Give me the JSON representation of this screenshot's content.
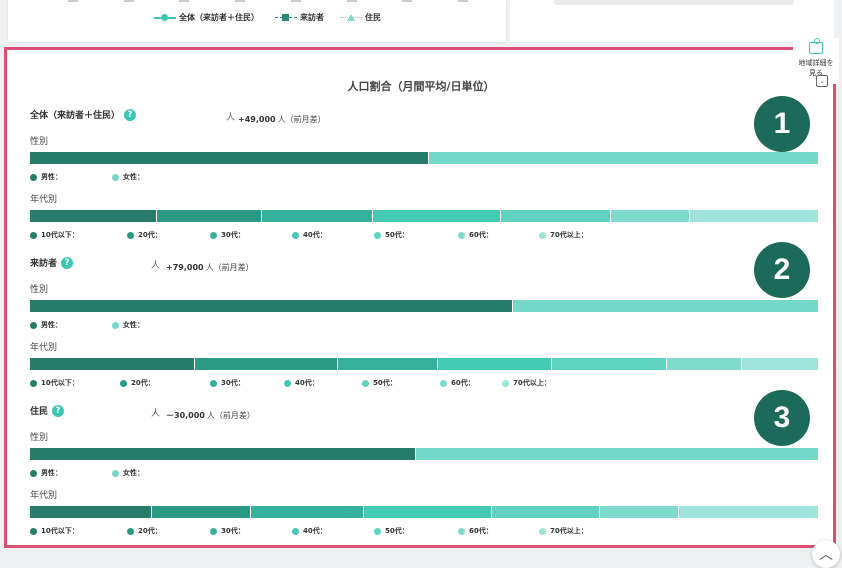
{
  "top_legend": [
    {
      "label": "全体（来訪者＋住民）",
      "color": "#3cc8b4",
      "marker": "circle",
      "line": "solid"
    },
    {
      "label": "来訪者",
      "color": "#2a8a76",
      "marker": "square",
      "line": "dash"
    },
    {
      "label": "住民",
      "color": "#7fdccd",
      "marker": "tri",
      "line": "dot"
    }
  ],
  "chart_title": "人口割合（月間平均/日単位）",
  "side_button": {
    "label_line1": "地域詳細を",
    "label_line2": "見る",
    "icon": "map-pin-icon"
  },
  "collapse_icon": "chevron-up-icon",
  "sex_label": "性別",
  "age_label": "年代別",
  "person_glyph": "人",
  "diff_unit": "人（前月差）",
  "sex_legend": [
    "男性：",
    "女性："
  ],
  "age_legend": [
    "10代以下：",
    "20代：",
    "30代：",
    "40代：",
    "50代：",
    "60代：",
    "70代以上："
  ],
  "sex_colors": [
    "#267c69",
    "#74d9c8"
  ],
  "age_colors": [
    "#267c69",
    "#2b9a84",
    "#36b29c",
    "#44c9b3",
    "#5ed3c0",
    "#7fdccd",
    "#9fe4d9"
  ],
  "sections": [
    {
      "title": "全体（来訪者＋住民）",
      "diff": "+49,000",
      "badge": "1",
      "sex_ratio": [
        0.506,
        0.494
      ],
      "age_ratio": [
        0.161,
        0.133,
        0.141,
        0.163,
        0.139,
        0.1,
        0.163
      ]
    },
    {
      "title": "来訪者",
      "diff": "+79,000",
      "badge": "2",
      "sex_ratio": [
        0.613,
        0.387
      ],
      "age_ratio": [
        0.21,
        0.181,
        0.127,
        0.145,
        0.146,
        0.095,
        0.096
      ]
    },
    {
      "title": "住民",
      "diff": "－30,000",
      "badge": "3",
      "sex_ratio": [
        0.49,
        0.51
      ],
      "age_ratio": [
        0.155,
        0.126,
        0.143,
        0.162,
        0.138,
        0.1,
        0.176
      ]
    }
  ]
}
